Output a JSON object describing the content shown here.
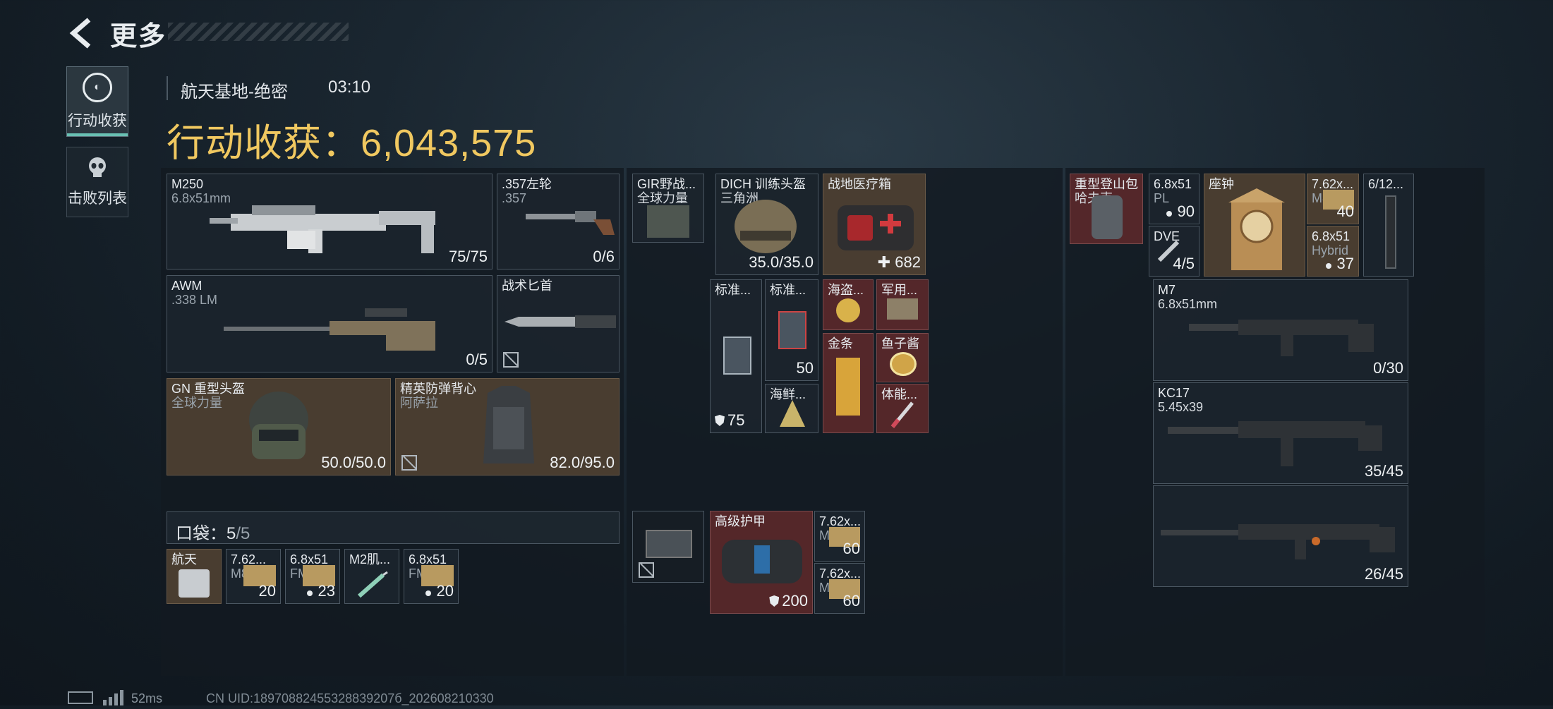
{
  "header": {
    "title": "更多",
    "back_icon": "chevron-left-icon"
  },
  "tabs": [
    {
      "label": "行动收获",
      "icon": "loot-icon",
      "active": true
    },
    {
      "label": "击败列表",
      "icon": "skull-icon",
      "active": false
    }
  ],
  "summary": {
    "map": "航天基地-绝密",
    "time": "03:10",
    "loot_label": "行动收获：",
    "loot_value": "6,043,575"
  },
  "equipment": {
    "primary1": {
      "name": "M250",
      "caliber": "6.8x51mm",
      "ammo": "75/75"
    },
    "pistol": {
      "name": ".357左轮",
      "caliber": ".357",
      "ammo": "0/6"
    },
    "primary2": {
      "name": "AWM",
      "caliber": ".338 LM",
      "ammo": "0/5"
    },
    "melee": {
      "name": "战术匕首"
    },
    "helmet": {
      "name": "GN 重型头盔",
      "sub": "全球力量",
      "durability": "50.0/50.0"
    },
    "armor": {
      "name": "精英防弹背心",
      "sub": "阿萨拉",
      "durability": "82.0/95.0"
    }
  },
  "pocket": {
    "label": "口袋：",
    "count": "5",
    "max": "/5",
    "items": [
      {
        "name": "航天",
        "value": ""
      },
      {
        "name": "7.62...",
        "sub": "M80",
        "value": "20"
      },
      {
        "name": "6.8x51",
        "sub": "FMJ",
        "value": "23"
      },
      {
        "name": "M2肌...",
        "value": ""
      },
      {
        "name": "6.8x51",
        "sub": "FMJ",
        "value": "20"
      }
    ]
  },
  "chest": {
    "items": [
      {
        "name": "GIR野战...",
        "sub": "全球力量"
      },
      {
        "name": "DICH 训练头盔",
        "sub": "三角洲",
        "value": "35.0/35.0"
      },
      {
        "name": "战地医疗箱",
        "value": "682"
      },
      {
        "name": "标准...",
        "value": "75"
      },
      {
        "name": "标准...",
        "value": "50"
      },
      {
        "name": "海盗...",
        "value": ""
      },
      {
        "name": "军用...",
        "value": ""
      },
      {
        "name": "金条",
        "value": ""
      },
      {
        "name": "鱼子酱",
        "value": ""
      },
      {
        "name": "海鲜...",
        "value": ""
      },
      {
        "name": "体能...",
        "value": ""
      }
    ]
  },
  "backpack_area": {
    "armor_plate": {
      "name": "",
      "value": ""
    },
    "advanced_armor": {
      "name": "高级护甲",
      "value": "200"
    },
    "ammo1": {
      "name": "7.62x...",
      "sub": "M80",
      "value": "60"
    },
    "ammo2": {
      "name": "7.62x...",
      "sub": "M80",
      "value": "60"
    }
  },
  "backpack": {
    "bag": {
      "name": "重型登山包",
      "sub": "哈夫克"
    },
    "ammo_pl": {
      "name": "6.8x51",
      "sub": "PL",
      "value": "90"
    },
    "dve": {
      "name": "DVE",
      "value": "4/5"
    },
    "clock": {
      "name": "座钟"
    },
    "ammo_762": {
      "name": "7.62x...",
      "sub": "M80",
      "value": "40"
    },
    "ammo_hybrid": {
      "name": "6.8x51",
      "sub": "Hybrid",
      "value": "37"
    },
    "scope": {
      "name": "6/12..."
    },
    "m7": {
      "name": "M7",
      "caliber": "6.8x51mm",
      "ammo": "0/30"
    },
    "kc17": {
      "name": "KC17",
      "caliber": "5.45x39",
      "ammo": "35/45"
    },
    "rifle3": {
      "name": "",
      "ammo": "26/45"
    }
  },
  "footer": {
    "ping": "52ms",
    "uid": "CN UID:18970882455328839207б_202608210330"
  },
  "colors": {
    "accent": "#f0c860",
    "teal": "#69c0b3",
    "brown_cell": "#4e4032",
    "red_cell": "#5a282a"
  }
}
